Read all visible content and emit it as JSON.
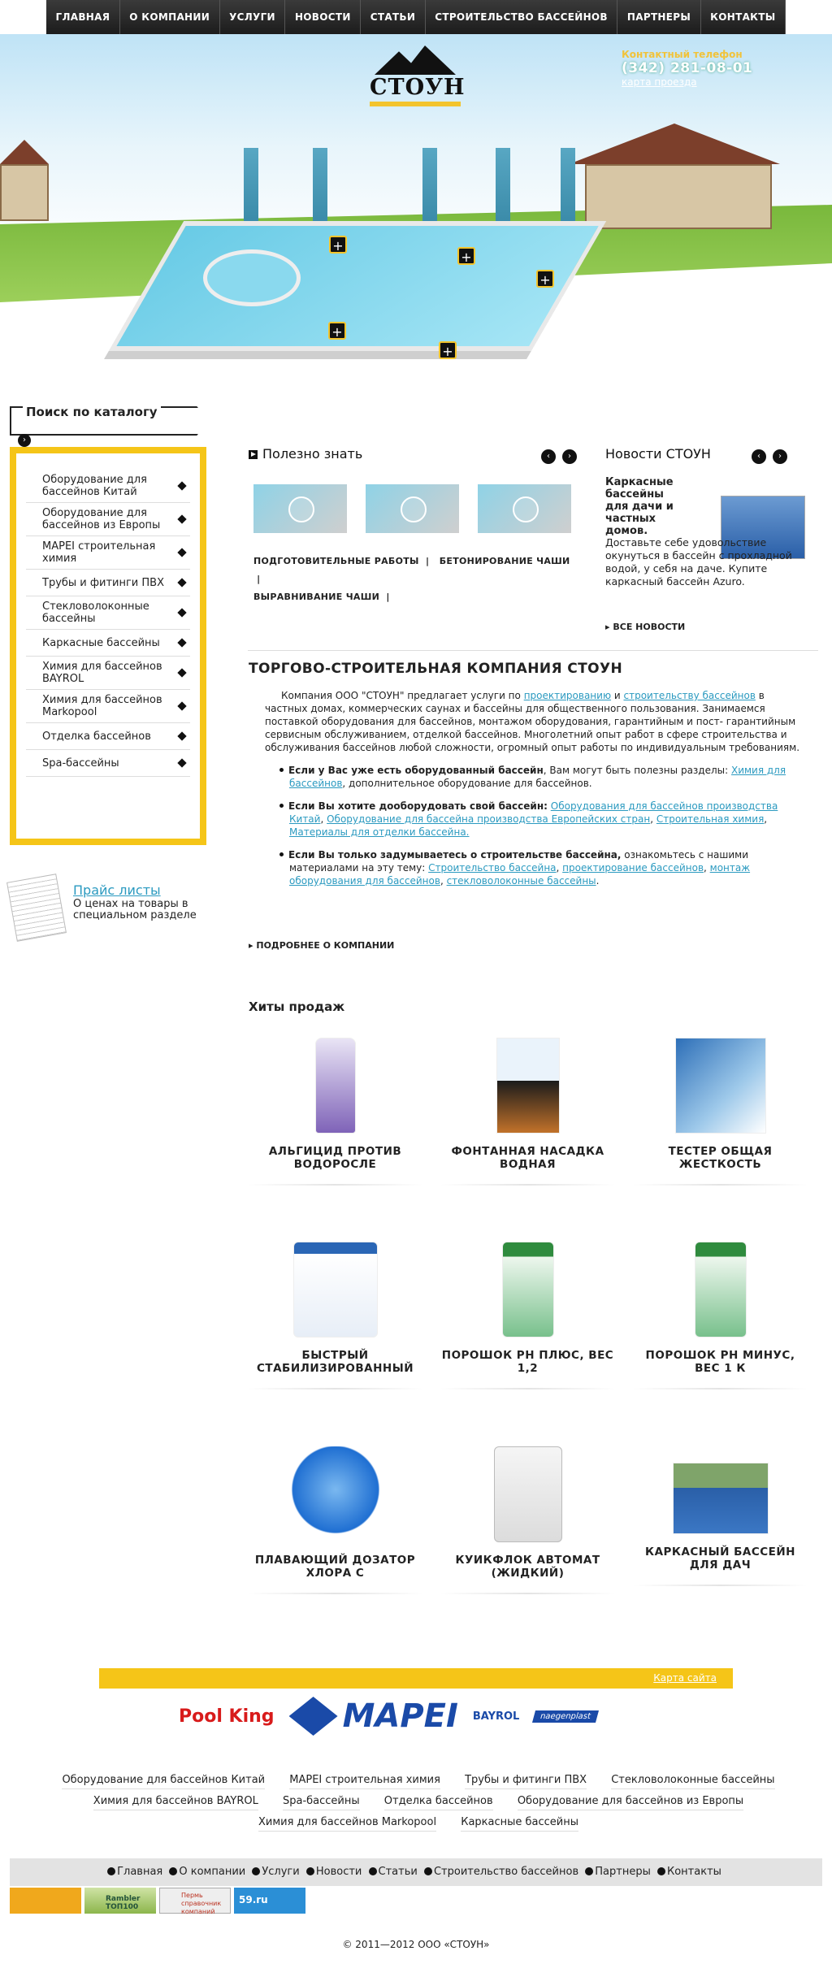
{
  "nav": [
    "ГЛАВНАЯ",
    "О КОМПАНИИ",
    "УСЛУГИ",
    "НОВОСТИ",
    "СТАТЬИ",
    "СТРОИТЕЛЬСТВО БАССЕЙНОВ",
    "ПАРТНЕРЫ",
    "КОНТАКТЫ"
  ],
  "brand": {
    "name": "СТОУН"
  },
  "contact": {
    "label": "Контактный телефон",
    "phone": "(342) 281-08-01",
    "map_link": "карта проезда"
  },
  "search": {
    "title": "Поиск по каталогу"
  },
  "catalog": [
    "Оборудование для бассейнов Китай",
    "Оборудование для бассейнов из Европы",
    "MAPEI строительная химия",
    "Трубы и фитинги ПВХ",
    "Стекловолоконные бассейны",
    "Каркасные бассейны",
    "Химия для бассейнов BAYROL",
    "Химия для бассейнов Markopool",
    "Отделка бассейнов",
    "Spa-бассейны"
  ],
  "price": {
    "link": "Прайс листы",
    "text": "О ценах на товары в специальном разделе"
  },
  "useful": {
    "title": "Полезно знать",
    "links": [
      "ПОДГОТОВИТЕЛЬНЫЕ РАБОТЫ",
      "БЕТОНИРОВАНИЕ ЧАШИ",
      "ВЫРАВНИВАНИЕ ЧАШИ"
    ]
  },
  "news": {
    "title": "Новости СТОУН",
    "item_title": "Каркасные бассейны для дачи и частных домов.",
    "item_text": "Доставьте себе удовольствие окунуться в бассейн с прохладной водой, у себя на даче. Купите каркасный бассейн Azuro.",
    "all": "ВСЕ НОВОСТИ"
  },
  "about": {
    "title": "ТОРГОВО-СТРОИТЕЛЬНАЯ КОМПАНИЯ СТОУН",
    "p1a": "Компания ООО \"СТОУН\" предлагает услуги по ",
    "p1l1": "проектированию",
    "p1b": " и ",
    "p1l2": "строительству бассейнов",
    "p1c": " в частных домах, коммерческих саунах и бассейны для общественного пользования. Занимаемся поставкой оборудования для бассейнов, монтажом оборудования, гарантийным и пост- гарантийным сервисным обслуживанием, отделкой бассейнов. Многолетний опыт работ в сфере строительства и обслуживания бассейнов любой сложности, огромный опыт работы по индивидуальным требованиям.",
    "b1": "Если у Вас уже есть оборудованный бассейн",
    "b1t": ", Вам могут быть полезны разделы: ",
    "b1l": "Химия для бассейнов",
    "b1e": ", дополнительное оборудование для бассейнов.",
    "b2": "Если Вы хотите дооборудовать свой бассейн:",
    "b2l1": "Оборудования для бассейнов производства Китай",
    "b2l2": "Оборудование для бассейна производства Европейских стран",
    "b2l3": "Строительная химия",
    "b2l4": "Материалы для отделки бассейна.",
    "b3": "Если Вы только задумываетесь о строительстве бассейна,",
    "b3t": " ознакомьтесь с нашими материалами на эту тему: ",
    "b3l1": "Строительство бассейна",
    "b3l2": "проектирование бассейнов",
    "b3l3": "монтаж оборудования для бассейнов",
    "b3l4": "стекловолоконные бассейны",
    "more": "ПОДРОБНЕЕ О КОМПАНИИ"
  },
  "hits": {
    "title": "Хиты продаж",
    "products": [
      "АЛЬГИЦИД ПРОТИВ ВОДОРОСЛЕ",
      "ФОНТАННАЯ НАСАДКА ВОДНАЯ",
      "ТЕСТЕР ОБЩАЯ ЖЕСТКОСТЬ",
      "БЫСТРЫЙ СТАБИЛИЗИРОВАННЫЙ",
      "ПОРОШОК PH ПЛЮС, ВЕС 1,2",
      "ПОРОШОК PH МИНУС, ВЕС 1 К",
      "ПЛАВАЮЩИЙ ДОЗАТОР ХЛОРА С",
      "КУИКФЛОК АВТОМАТ (ЖИДКИЙ)",
      "КАРКАСНЫЙ БАССЕЙН ДЛЯ ДАЧ"
    ]
  },
  "footer": {
    "sitemap": "Карта сайта",
    "brands": [
      "Pool King",
      "MAPEI",
      "BAYROL",
      "naegenplast"
    ],
    "catalog_links": [
      "Оборудование для бассейнов Китай",
      "MAPEI строительная химия",
      "Трубы и фитинги ПВХ",
      "Стекловолоконные бассейны",
      "Химия для бассейнов BAYROL",
      "Spa-бассейны",
      "Отделка бассейнов",
      "Оборудование для бассейнов из Европы",
      "Химия для бассейнов Markopool",
      "Каркасные бассейны"
    ],
    "menu": [
      "Главная",
      "О компании",
      "Услуги",
      "Новости",
      "Статьи",
      "Строительство бассейнов",
      "Партнеры",
      "Контакты"
    ],
    "counters": [
      "Rambler ТОП100",
      "Пермь справочник компаний",
      "59.ru"
    ],
    "copyright": "© 2011—2012 ООО «СТОУН»"
  },
  "colors": {
    "accent": "#f5c518",
    "link": "#2b9ac0",
    "nav": "#222222"
  }
}
